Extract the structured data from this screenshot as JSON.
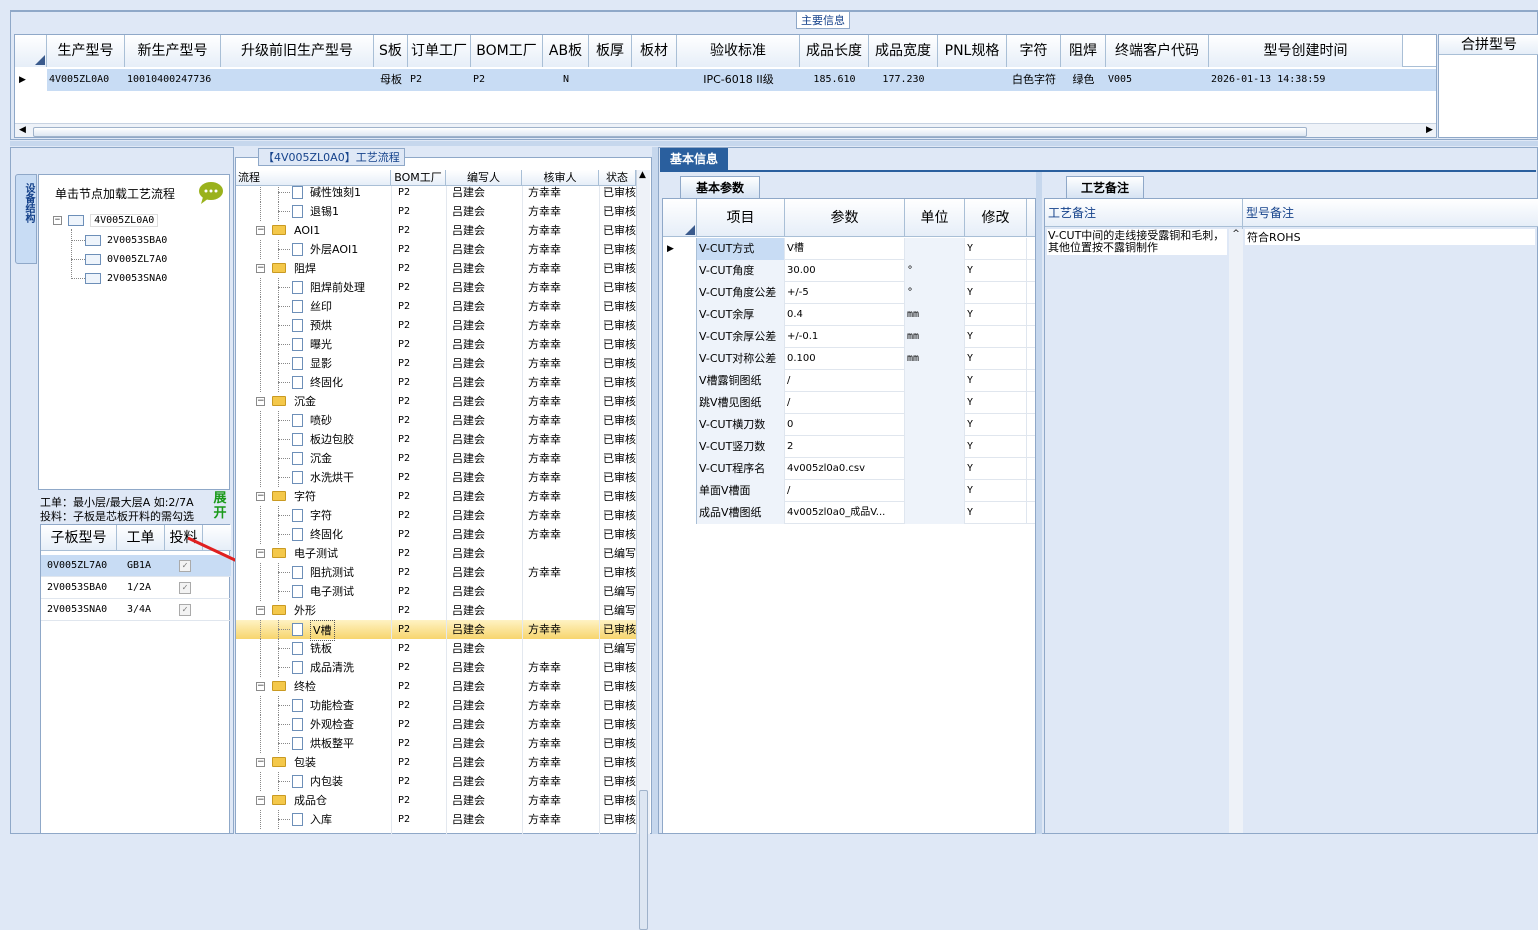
{
  "main_info": {
    "group_label": "主要信息",
    "columns": [
      "生产型号",
      "新生产型号",
      "升级前旧生产型号",
      "S板",
      "订单工厂",
      "BOM工厂",
      "AB板",
      "板厚",
      "板材",
      "验收标准",
      "成品长度",
      "成品宽度",
      "PNL规格",
      "字符",
      "阻焊",
      "终端客户代码",
      "型号创建时间"
    ],
    "row": {
      "prod": "4V005ZL0A0",
      "new_prod": "10010400247736",
      "old": "",
      "sboard": "母板",
      "order_factory": "P2",
      "bom_factory": "P2",
      "ab": "N",
      "thickness": "",
      "material": "",
      "standard": "IPC-6018 II级",
      "length": "185.610",
      "width": "177.230",
      "pnl": "",
      "char": "白色字符",
      "mask": "绿色",
      "customer": "V005",
      "created": "2026-01-13 14:38:59"
    },
    "merge_header": "合拼型号"
  },
  "left_panel": {
    "vertical_tab": "设备结构",
    "load_hint": "单击节点加载工艺流程",
    "tree_root": "4V005ZL0A0",
    "tree_children": [
      "2V0053SBA0",
      "0V005ZL7A0",
      "2V0053SNA0"
    ],
    "layer_hint_1": "工单：最小层/最大层A 如:2/7A",
    "layer_hint_2": "投料：子板是芯板开料的需勾选",
    "expand_button": "展开",
    "sub_columns": [
      "子板型号",
      "工单",
      "投料"
    ],
    "sub_rows": [
      {
        "model": "0V005ZL7A0",
        "order": "GB1A"
      },
      {
        "model": "2V0053SBA0",
        "order": "1/2A"
      },
      {
        "model": "2V0053SNA0",
        "order": "3/4A"
      }
    ]
  },
  "flow_panel": {
    "group_label": "【4V005ZL0A0】工艺流程",
    "columns": [
      "流程",
      "BOM工厂",
      "编写人",
      "核审人",
      "状态"
    ],
    "rows": [
      {
        "level": 2,
        "name": "碱性蚀刻1",
        "bom": "P2",
        "writer": "吕建会",
        "reviewer": "方幸幸",
        "status": "已审核"
      },
      {
        "level": 2,
        "name": "退锡1",
        "bom": "P2",
        "writer": "吕建会",
        "reviewer": "方幸幸",
        "status": "已审核"
      },
      {
        "level": 1,
        "name": "AOI1",
        "bom": "P2",
        "writer": "吕建会",
        "reviewer": "方幸幸",
        "status": "已审核"
      },
      {
        "level": 2,
        "name": "外层AOI1",
        "bom": "P2",
        "writer": "吕建会",
        "reviewer": "方幸幸",
        "status": "已审核"
      },
      {
        "level": 1,
        "name": "阻焊",
        "bom": "P2",
        "writer": "吕建会",
        "reviewer": "方幸幸",
        "status": "已审核"
      },
      {
        "level": 2,
        "name": "阻焊前处理",
        "bom": "P2",
        "writer": "吕建会",
        "reviewer": "方幸幸",
        "status": "已审核"
      },
      {
        "level": 2,
        "name": "丝印",
        "bom": "P2",
        "writer": "吕建会",
        "reviewer": "方幸幸",
        "status": "已审核"
      },
      {
        "level": 2,
        "name": "预烘",
        "bom": "P2",
        "writer": "吕建会",
        "reviewer": "方幸幸",
        "status": "已审核"
      },
      {
        "level": 2,
        "name": "曝光",
        "bom": "P2",
        "writer": "吕建会",
        "reviewer": "方幸幸",
        "status": "已审核"
      },
      {
        "level": 2,
        "name": "显影",
        "bom": "P2",
        "writer": "吕建会",
        "reviewer": "方幸幸",
        "status": "已审核"
      },
      {
        "level": 2,
        "name": "终固化",
        "bom": "P2",
        "writer": "吕建会",
        "reviewer": "方幸幸",
        "status": "已审核"
      },
      {
        "level": 1,
        "name": "沉金",
        "bom": "P2",
        "writer": "吕建会",
        "reviewer": "方幸幸",
        "status": "已审核"
      },
      {
        "level": 2,
        "name": "喷砂",
        "bom": "P2",
        "writer": "吕建会",
        "reviewer": "方幸幸",
        "status": "已审核"
      },
      {
        "level": 2,
        "name": "板边包胶",
        "bom": "P2",
        "writer": "吕建会",
        "reviewer": "方幸幸",
        "status": "已审核"
      },
      {
        "level": 2,
        "name": "沉金",
        "bom": "P2",
        "writer": "吕建会",
        "reviewer": "方幸幸",
        "status": "已审核"
      },
      {
        "level": 2,
        "name": "水洗烘干",
        "bom": "P2",
        "writer": "吕建会",
        "reviewer": "方幸幸",
        "status": "已审核"
      },
      {
        "level": 1,
        "name": "字符",
        "bom": "P2",
        "writer": "吕建会",
        "reviewer": "方幸幸",
        "status": "已审核"
      },
      {
        "level": 2,
        "name": "字符",
        "bom": "P2",
        "writer": "吕建会",
        "reviewer": "方幸幸",
        "status": "已审核"
      },
      {
        "level": 2,
        "name": "终固化",
        "bom": "P2",
        "writer": "吕建会",
        "reviewer": "方幸幸",
        "status": "已审核"
      },
      {
        "level": 1,
        "name": "电子测试",
        "bom": "P2",
        "writer": "吕建会",
        "reviewer": "",
        "status": "已编写"
      },
      {
        "level": 2,
        "name": "阻抗测试",
        "bom": "P2",
        "writer": "吕建会",
        "reviewer": "方幸幸",
        "status": "已审核"
      },
      {
        "level": 2,
        "name": "电子测试",
        "bom": "P2",
        "writer": "吕建会",
        "reviewer": "",
        "status": "已编写"
      },
      {
        "level": 1,
        "name": "外形",
        "bom": "P2",
        "writer": "吕建会",
        "reviewer": "",
        "status": "已编写"
      },
      {
        "level": 2,
        "name": "V槽",
        "bom": "P2",
        "writer": "吕建会",
        "reviewer": "方幸幸",
        "status": "已审核",
        "selected": true
      },
      {
        "level": 2,
        "name": "铣板",
        "bom": "P2",
        "writer": "吕建会",
        "reviewer": "",
        "status": "已编写"
      },
      {
        "level": 2,
        "name": "成品清洗",
        "bom": "P2",
        "writer": "吕建会",
        "reviewer": "方幸幸",
        "status": "已审核"
      },
      {
        "level": 1,
        "name": "终检",
        "bom": "P2",
        "writer": "吕建会",
        "reviewer": "方幸幸",
        "status": "已审核"
      },
      {
        "level": 2,
        "name": "功能检查",
        "bom": "P2",
        "writer": "吕建会",
        "reviewer": "方幸幸",
        "status": "已审核"
      },
      {
        "level": 2,
        "name": "外观检查",
        "bom": "P2",
        "writer": "吕建会",
        "reviewer": "方幸幸",
        "status": "已审核"
      },
      {
        "level": 2,
        "name": "烘板整平",
        "bom": "P2",
        "writer": "吕建会",
        "reviewer": "方幸幸",
        "status": "已审核"
      },
      {
        "level": 1,
        "name": "包装",
        "bom": "P2",
        "writer": "吕建会",
        "reviewer": "方幸幸",
        "status": "已审核"
      },
      {
        "level": 2,
        "name": "内包装",
        "bom": "P2",
        "writer": "吕建会",
        "reviewer": "方幸幸",
        "status": "已审核"
      },
      {
        "level": 1,
        "name": "成品仓",
        "bom": "P2",
        "writer": "吕建会",
        "reviewer": "方幸幸",
        "status": "已审核"
      },
      {
        "level": 2,
        "name": "入库",
        "bom": "P2",
        "writer": "吕建会",
        "reviewer": "方幸幸",
        "status": "已审核"
      }
    ]
  },
  "basic_info": {
    "tab": "基本信息",
    "params_tab": "基本参数",
    "columns": [
      "项目",
      "参数",
      "单位",
      "修改"
    ],
    "rows": [
      {
        "item": "V-CUT方式",
        "value": "V槽",
        "unit": "",
        "mod": "Y"
      },
      {
        "item": "V-CUT角度",
        "value": "30.00",
        "unit": "°",
        "mod": "Y"
      },
      {
        "item": "V-CUT角度公差",
        "value": "+/-5",
        "unit": "°",
        "mod": "Y"
      },
      {
        "item": "V-CUT余厚",
        "value": "0.4",
        "unit": "mm",
        "mod": "Y"
      },
      {
        "item": "V-CUT余厚公差",
        "value": "+/-0.1",
        "unit": "mm",
        "mod": "Y"
      },
      {
        "item": "V-CUT对称公差",
        "value": "0.100",
        "unit": "mm",
        "mod": "Y"
      },
      {
        "item": "V槽露铜图纸",
        "value": "/",
        "unit": "",
        "mod": "Y"
      },
      {
        "item": "跳V槽见图纸",
        "value": "/",
        "unit": "",
        "mod": "Y"
      },
      {
        "item": "V-CUT横刀数",
        "value": "0",
        "unit": "",
        "mod": "Y"
      },
      {
        "item": "V-CUT竖刀数",
        "value": "2",
        "unit": "",
        "mod": "Y"
      },
      {
        "item": "V-CUT程序名",
        "value": "4v005zl0a0.csv",
        "unit": "",
        "mod": "Y"
      },
      {
        "item": "单面V槽面",
        "value": "/",
        "unit": "",
        "mod": "Y"
      },
      {
        "item": "成品V槽图纸",
        "value": "4v005zl0a0_成品V...",
        "unit": "",
        "mod": "Y"
      }
    ]
  },
  "remarks": {
    "tab": "工艺备注",
    "col1": "工艺备注",
    "col2": "型号备注",
    "note": "V-CUT中间的走线接受露铜和毛刺，其他位置按不露铜制作",
    "model_note": "符合ROHS"
  }
}
